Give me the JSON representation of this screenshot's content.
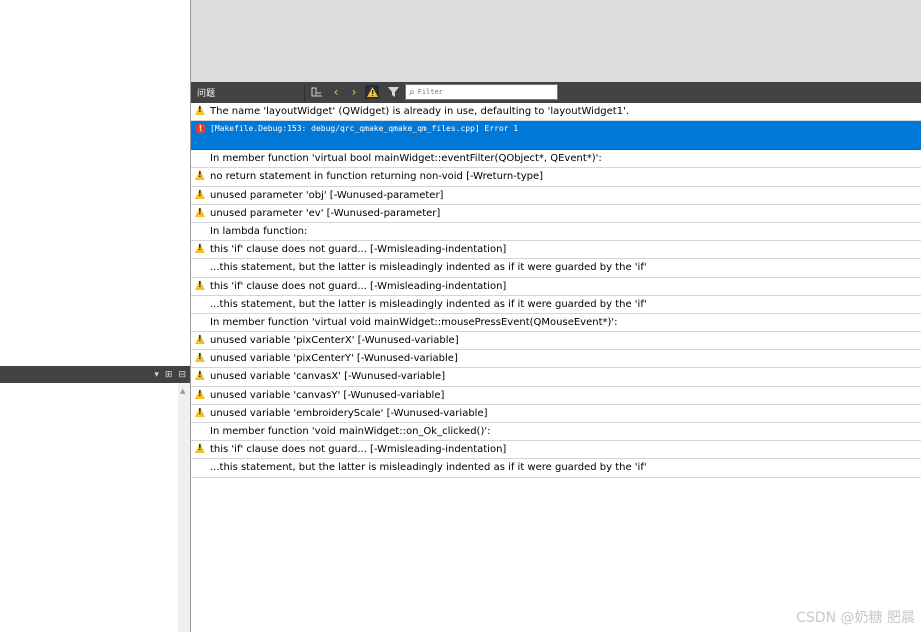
{
  "issues_panel": {
    "title": "问题",
    "filter_placeholder": "Filter",
    "icons": {
      "build_steps": "build-steps-icon",
      "prev": "chevron-left-icon",
      "next": "chevron-right-icon",
      "warnings_toggle": "warning-icon",
      "filter": "filter-icon",
      "search": "search-icon"
    },
    "rows": [
      {
        "kind": "warning",
        "text": "The name 'layoutWidget' (QWidget) is already in use, defaulting to 'layoutWidget1'."
      },
      {
        "kind": "error",
        "text": "[Makefile.Debug:153: debug/qrc_qmake_qmake_qm_files.cpp] Error 1",
        "selected": true
      },
      {
        "kind": "info",
        "text": "In member function 'virtual bool mainWidget::eventFilter(QObject*, QEvent*)':"
      },
      {
        "kind": "warning",
        "text": "no return statement in function returning non-void [-Wreturn-type]"
      },
      {
        "kind": "warning",
        "text": "unused parameter 'obj' [-Wunused-parameter]"
      },
      {
        "kind": "warning",
        "text": "unused parameter 'ev' [-Wunused-parameter]"
      },
      {
        "kind": "info",
        "text": "In lambda function:"
      },
      {
        "kind": "warning",
        "text": "this 'if' clause does not guard... [-Wmisleading-indentation]"
      },
      {
        "kind": "info",
        "text": "...this statement, but the latter is misleadingly indented as if it were guarded by the 'if'"
      },
      {
        "kind": "warning",
        "text": "this 'if' clause does not guard... [-Wmisleading-indentation]"
      },
      {
        "kind": "info",
        "text": "...this statement, but the latter is misleadingly indented as if it were guarded by the 'if'"
      },
      {
        "kind": "info",
        "text": "In member function 'virtual void mainWidget::mousePressEvent(QMouseEvent*)':"
      },
      {
        "kind": "warning",
        "text": "unused variable 'pixCenterX' [-Wunused-variable]"
      },
      {
        "kind": "warning",
        "text": "unused variable 'pixCenterY' [-Wunused-variable]"
      },
      {
        "kind": "warning",
        "text": "unused variable 'canvasX' [-Wunused-variable]"
      },
      {
        "kind": "warning",
        "text": "unused variable 'canvasY' [-Wunused-variable]"
      },
      {
        "kind": "warning",
        "text": "unused variable 'embroideryScale' [-Wunused-variable]"
      },
      {
        "kind": "info",
        "text": "In member function 'void mainWidget::on_Ok_clicked()':"
      },
      {
        "kind": "warning",
        "text": "this 'if' clause does not guard... [-Wmisleading-indentation]"
      },
      {
        "kind": "info",
        "text": "...this statement, but the latter is misleadingly indented as if it were guarded by the 'if'"
      }
    ]
  },
  "left_panel": {
    "toolbar_icons": [
      "dropdown-arrow-icon",
      "split-icon",
      "close-pane-icon"
    ]
  },
  "watermark": "CSDN @奶糖 肥晨",
  "colors": {
    "toolbar_bg": "#404244",
    "selection": "#0078d7",
    "warning": "#f2c12e",
    "error": "#e23d2d"
  }
}
